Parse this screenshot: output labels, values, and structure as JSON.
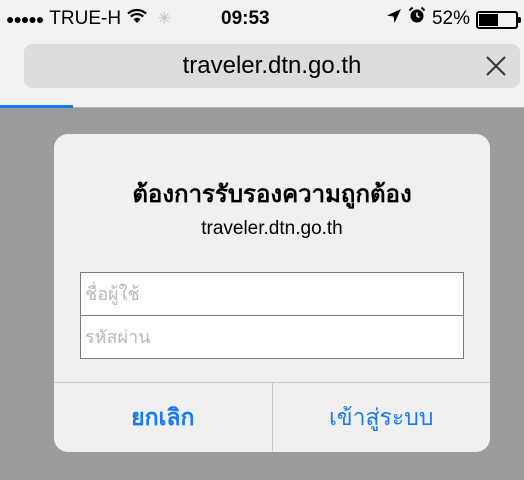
{
  "status_bar": {
    "signal_dots": "●●●●●",
    "carrier": "TRUE-H",
    "time": "09:53",
    "battery_percent": "52%",
    "battery_level": 0.52,
    "icons": [
      "signal-dots-icon",
      "wifi-icon",
      "activity-spinner-icon",
      "location-arrow-icon",
      "alarm-clock-icon",
      "battery-icon"
    ]
  },
  "address_bar": {
    "url": "traveler.dtn.go.th",
    "load_progress": 0.14
  },
  "auth_dialog": {
    "title": "ต้องการรับรองความถูกต้อง",
    "message": "traveler.dtn.go.th",
    "username_placeholder": "ชื่อผู้ใช้",
    "password_placeholder": "รหัสผ่าน",
    "cancel_label": "ยกเลิก",
    "login_label": "เข้าสู่ระบบ"
  },
  "colors": {
    "accent": "#1a78f2",
    "overlay": "#9c9c9c",
    "dialog_bg": "#f0f0f0"
  }
}
